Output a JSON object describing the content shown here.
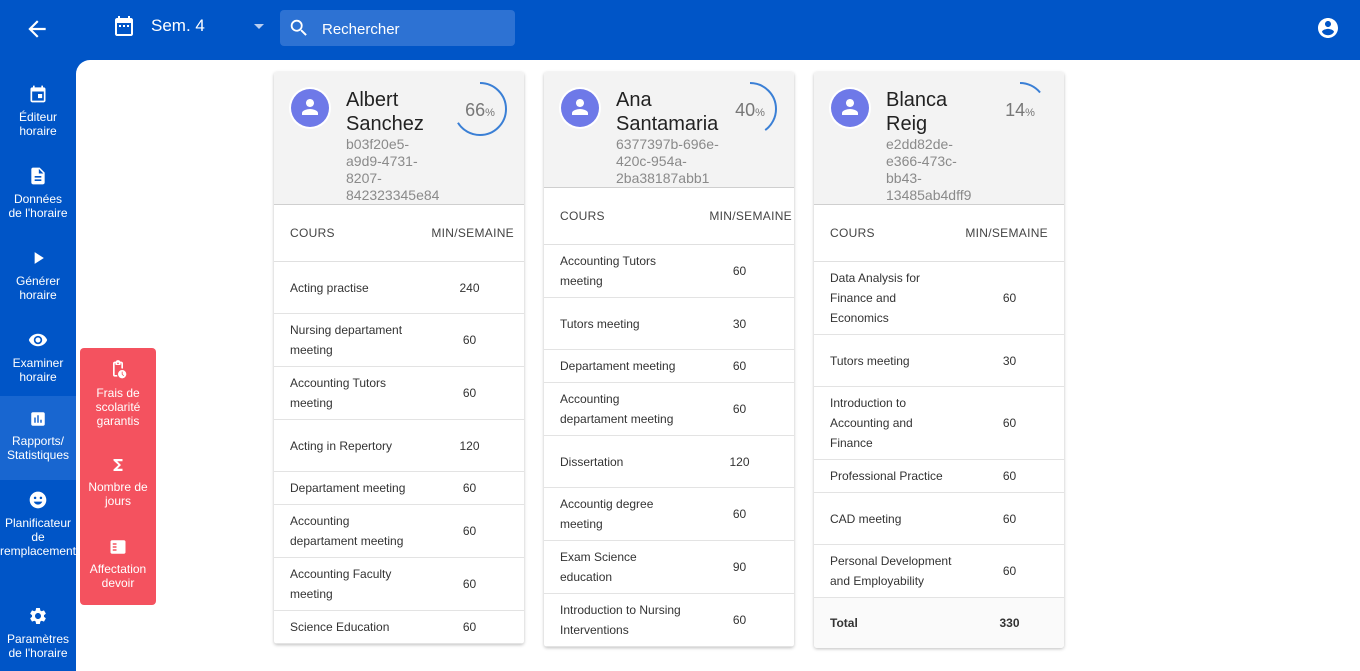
{
  "topbar": {
    "semester": "Sem. 4",
    "search_placeholder": "Rechercher"
  },
  "sidebar": {
    "items": [
      {
        "label_1": "Éditeur",
        "label_2": "horaire",
        "icon": "calendar-icon"
      },
      {
        "label_1": "Données",
        "label_2": "de l'horaire",
        "icon": "document-icon"
      },
      {
        "label_1": "Générer",
        "label_2": "horaire",
        "icon": "play-icon"
      },
      {
        "label_1": "Examiner",
        "label_2": "horaire",
        "icon": "eye-icon"
      },
      {
        "label_1": "Rapports/",
        "label_2": "Statistiques",
        "icon": "chart-icon"
      },
      {
        "label_1": "Planificateur",
        "label_2": "de",
        "label_3": "remplacement",
        "icon": "face-icon"
      },
      {
        "label_1": "Paramètres",
        "label_2": "de l'horaire",
        "icon": "gear-icon"
      }
    ]
  },
  "submenu": {
    "items": [
      {
        "label_1": "Frais de",
        "label_2": "scolarité",
        "label_3": "garantis",
        "icon": "clipboard-clock-icon"
      },
      {
        "label_1": "Nombre de",
        "label_2": "jours",
        "icon": "sigma-icon"
      },
      {
        "label_1": "Affectation",
        "label_2": "devoir",
        "icon": "assignment-check-icon"
      }
    ]
  },
  "table_headers": {
    "course": "COURS",
    "minutes": "MIN/SEMAINE"
  },
  "cards": [
    {
      "name_1": "Albert",
      "name_2": "Sanchez",
      "id_lines": [
        "b03f20e5-",
        "a9d9-4731-",
        "8207-",
        "842323345e84"
      ],
      "percent": "66",
      "percent_symbol": "%",
      "percent_value": 0.66,
      "rows": [
        {
          "course": "Acting practise",
          "min": "240"
        },
        {
          "course": "Nursing departament meeting",
          "min": "60"
        },
        {
          "course": "Accounting Tutors meeting",
          "min": "60"
        },
        {
          "course": "Acting in Repertory",
          "min": "120"
        },
        {
          "course": "Departament meeting",
          "min": "60"
        },
        {
          "course": "Accounting departament meeting",
          "min": "60"
        },
        {
          "course": "Accounting Faculty meeting",
          "min": "60"
        },
        {
          "course": "Science Education",
          "min": "60"
        }
      ]
    },
    {
      "name_1": "Ana",
      "name_2": "Santamaria",
      "id_lines": [
        "6377397b-696e-",
        "420c-954a-",
        "2ba38187abb1"
      ],
      "percent": "40",
      "percent_symbol": "%",
      "percent_value": 0.4,
      "rows": [
        {
          "course": "Accounting Tutors meeting",
          "min": "60"
        },
        {
          "course": "Tutors meeting",
          "min": "30"
        },
        {
          "course": "Departament meeting",
          "min": "60"
        },
        {
          "course": "Accounting departament meeting",
          "min": "60"
        },
        {
          "course": "Dissertation",
          "min": "120"
        },
        {
          "course": "Accountig degree meeting",
          "min": "60"
        },
        {
          "course": "Exam Science education",
          "min": "90"
        },
        {
          "course": "Introduction to Nursing Interventions",
          "min": "60"
        }
      ]
    },
    {
      "name_1": "Blanca",
      "name_2": "Reig",
      "id_lines": [
        "e2dd82de-",
        "e366-473c-",
        "bb43-",
        "13485ab4dff9"
      ],
      "percent": "14",
      "percent_symbol": "%",
      "percent_value": 0.14,
      "rows": [
        {
          "course": "Data Analysis for Finance and Economics",
          "min": "60"
        },
        {
          "course": "Tutors meeting",
          "min": "30"
        },
        {
          "course": "Introduction to Accounting and Finance",
          "min": "60"
        },
        {
          "course": "Professional Practice",
          "min": "60"
        },
        {
          "course": "CAD meeting",
          "min": "60"
        },
        {
          "course": "Personal Development and Employability",
          "min": "60"
        }
      ],
      "total_label": "Total",
      "total_value": "330"
    }
  ]
}
